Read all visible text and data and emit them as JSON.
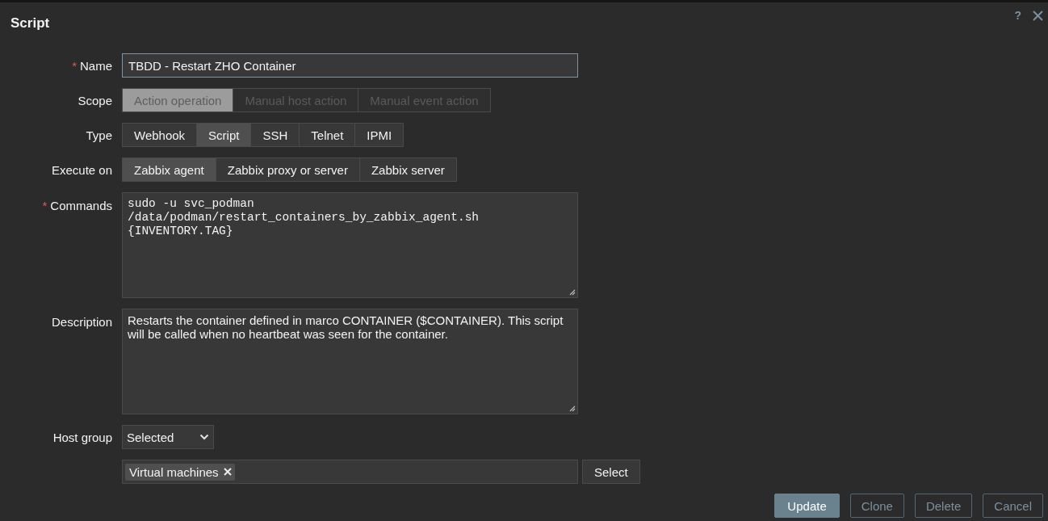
{
  "dialog": {
    "title": "Script",
    "help": "?"
  },
  "name_field": {
    "label": "Name",
    "required_mark": "*",
    "value": "TBDD - Restart ZHO Container"
  },
  "scope": {
    "label": "Scope",
    "options": [
      {
        "label": "Action operation",
        "selected": true,
        "disabled": true
      },
      {
        "label": "Manual host action",
        "selected": false,
        "disabled": true
      },
      {
        "label": "Manual event action",
        "selected": false,
        "disabled": true
      }
    ]
  },
  "type": {
    "label": "Type",
    "options": [
      {
        "label": "Webhook",
        "selected": false,
        "disabled": false
      },
      {
        "label": "Script",
        "selected": true,
        "disabled": false
      },
      {
        "label": "SSH",
        "selected": false,
        "disabled": false
      },
      {
        "label": "Telnet",
        "selected": false,
        "disabled": false
      },
      {
        "label": "IPMI",
        "selected": false,
        "disabled": false
      }
    ]
  },
  "execute_on": {
    "label": "Execute on",
    "options": [
      {
        "label": "Zabbix agent",
        "selected": true,
        "disabled": false
      },
      {
        "label": "Zabbix proxy or server",
        "selected": false,
        "disabled": false
      },
      {
        "label": "Zabbix server",
        "selected": false,
        "disabled": false
      }
    ]
  },
  "commands": {
    "label": "Commands",
    "required_mark": "*",
    "value": "sudo -u svc_podman\n/data/podman/restart_containers_by_zabbix_agent.sh\n{INVENTORY.TAG}"
  },
  "description": {
    "label": "Description",
    "value": "Restarts the container defined in marco CONTAINER ($CONTAINER). This script will be called when no heartbeat was seen for the container."
  },
  "host_group": {
    "label": "Host group",
    "value": "Selected",
    "tags": [
      "Virtual machines"
    ],
    "select_button": "Select"
  },
  "buttons": [
    {
      "label": "Update",
      "kind": "primary"
    },
    {
      "label": "Clone",
      "kind": "secondary"
    },
    {
      "label": "Delete",
      "kind": "secondary"
    },
    {
      "label": "Cancel",
      "kind": "secondary"
    }
  ]
}
